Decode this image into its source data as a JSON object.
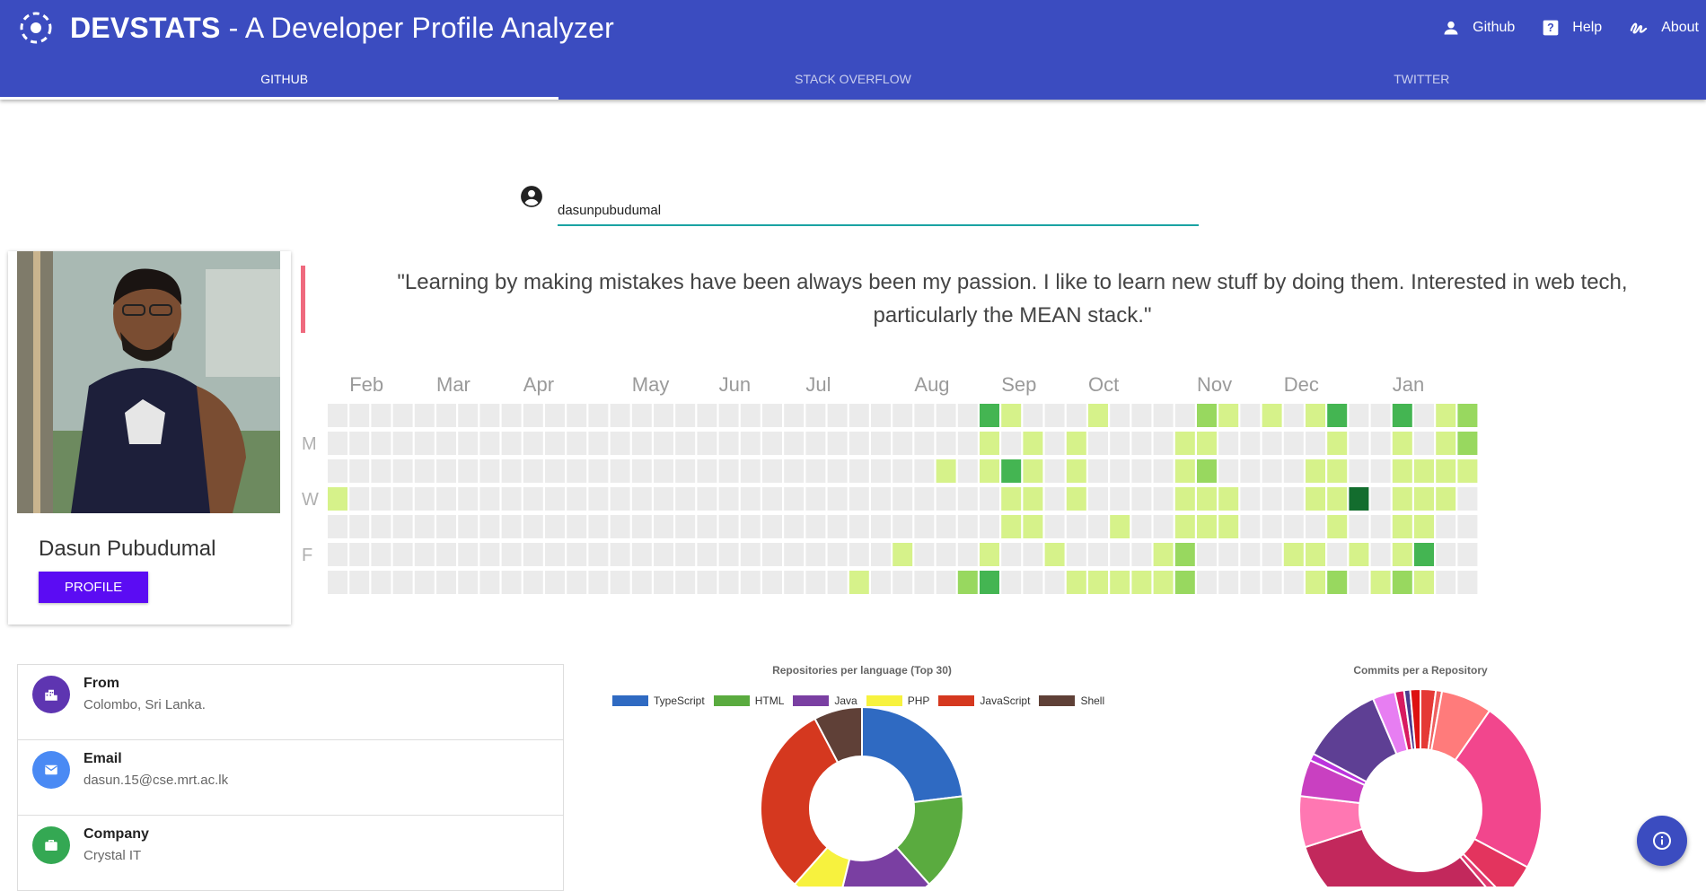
{
  "app": {
    "title_strong": "DEVSTATS",
    "title_rest": " - A Developer Profile Analyzer",
    "nav": [
      {
        "label": "Github",
        "icon": "person-icon"
      },
      {
        "label": "Help",
        "icon": "help-icon"
      },
      {
        "label": "About",
        "icon": "about-icon"
      }
    ],
    "tabs": [
      {
        "label": "GITHUB",
        "active": true
      },
      {
        "label": "STACK OVERFLOW",
        "active": false
      },
      {
        "label": "TWITTER",
        "active": false
      }
    ],
    "colors": {
      "primary": "#3b4cc0",
      "accent_button": "#5b0cf3"
    }
  },
  "search": {
    "value": "dasunpubudumal"
  },
  "profile": {
    "name": "Dasun Pubudumal",
    "button_label": "PROFILE"
  },
  "bio": "\"Learning by making mistakes have been always been my passion. I like to learn new stuff by doing them. Interested in web tech, particularly the MEAN stack.\"",
  "heatmap": {
    "months": [
      {
        "label": "Feb",
        "week": 1
      },
      {
        "label": "Mar",
        "week": 5
      },
      {
        "label": "Apr",
        "week": 9
      },
      {
        "label": "May",
        "week": 14
      },
      {
        "label": "Jun",
        "week": 18
      },
      {
        "label": "Jul",
        "week": 22
      },
      {
        "label": "Aug",
        "week": 27
      },
      {
        "label": "Sep",
        "week": 31
      },
      {
        "label": "Oct",
        "week": 35
      },
      {
        "label": "Nov",
        "week": 40
      },
      {
        "label": "Dec",
        "week": 44
      },
      {
        "label": "Jan",
        "week": 49
      }
    ],
    "day_labels": [
      {
        "label": "M",
        "row": 1
      },
      {
        "label": "W",
        "row": 3
      },
      {
        "label": "F",
        "row": 5
      }
    ],
    "colors": [
      "#ebebeb",
      "#d6f28a",
      "#98d85f",
      "#44b552",
      "#136d2e"
    ],
    "weeks": [
      [
        0,
        0,
        0,
        1,
        0,
        0,
        0
      ],
      [
        0,
        0,
        0,
        0,
        0,
        0,
        0
      ],
      [
        0,
        0,
        0,
        0,
        0,
        0,
        0
      ],
      [
        0,
        0,
        0,
        0,
        0,
        0,
        0
      ],
      [
        0,
        0,
        0,
        0,
        0,
        0,
        0
      ],
      [
        0,
        0,
        0,
        0,
        0,
        0,
        0
      ],
      [
        0,
        0,
        0,
        0,
        0,
        0,
        0
      ],
      [
        0,
        0,
        0,
        0,
        0,
        0,
        0
      ],
      [
        0,
        0,
        0,
        0,
        0,
        0,
        0
      ],
      [
        0,
        0,
        0,
        0,
        0,
        0,
        0
      ],
      [
        0,
        0,
        0,
        0,
        0,
        0,
        0
      ],
      [
        0,
        0,
        0,
        0,
        0,
        0,
        0
      ],
      [
        0,
        0,
        0,
        0,
        0,
        0,
        0
      ],
      [
        0,
        0,
        0,
        0,
        0,
        0,
        0
      ],
      [
        0,
        0,
        0,
        0,
        0,
        0,
        0
      ],
      [
        0,
        0,
        0,
        0,
        0,
        0,
        0
      ],
      [
        0,
        0,
        0,
        0,
        0,
        0,
        0
      ],
      [
        0,
        0,
        0,
        0,
        0,
        0,
        0
      ],
      [
        0,
        0,
        0,
        0,
        0,
        0,
        0
      ],
      [
        0,
        0,
        0,
        0,
        0,
        0,
        0
      ],
      [
        0,
        0,
        0,
        0,
        0,
        0,
        0
      ],
      [
        0,
        0,
        0,
        0,
        0,
        0,
        0
      ],
      [
        0,
        0,
        0,
        0,
        0,
        0,
        0
      ],
      [
        0,
        0,
        0,
        0,
        0,
        0,
        0
      ],
      [
        0,
        0,
        0,
        0,
        0,
        0,
        1
      ],
      [
        0,
        0,
        0,
        0,
        0,
        0,
        0
      ],
      [
        0,
        0,
        0,
        0,
        0,
        1,
        0
      ],
      [
        0,
        0,
        0,
        0,
        0,
        0,
        0
      ],
      [
        0,
        0,
        1,
        0,
        0,
        0,
        0
      ],
      [
        0,
        0,
        0,
        0,
        0,
        0,
        2
      ],
      [
        3,
        1,
        1,
        0,
        0,
        1,
        3
      ],
      [
        1,
        0,
        3,
        1,
        1,
        0,
        0
      ],
      [
        0,
        1,
        1,
        1,
        1,
        0,
        0
      ],
      [
        0,
        0,
        0,
        0,
        0,
        1,
        0
      ],
      [
        0,
        1,
        1,
        1,
        0,
        0,
        1
      ],
      [
        1,
        0,
        0,
        0,
        0,
        0,
        1
      ],
      [
        0,
        0,
        0,
        0,
        1,
        0,
        1
      ],
      [
        0,
        0,
        0,
        0,
        0,
        0,
        1
      ],
      [
        0,
        0,
        0,
        0,
        0,
        1,
        1
      ],
      [
        0,
        1,
        1,
        1,
        1,
        2,
        2
      ],
      [
        2,
        1,
        2,
        1,
        1,
        0,
        0
      ],
      [
        1,
        0,
        0,
        1,
        1,
        0,
        0
      ],
      [
        0,
        0,
        0,
        0,
        0,
        0,
        0
      ],
      [
        1,
        0,
        0,
        0,
        0,
        0,
        0
      ],
      [
        0,
        0,
        0,
        0,
        0,
        1,
        0
      ],
      [
        1,
        0,
        1,
        1,
        0,
        1,
        1
      ],
      [
        3,
        1,
        1,
        1,
        1,
        0,
        2
      ],
      [
        0,
        0,
        0,
        4,
        0,
        1,
        0
      ],
      [
        0,
        0,
        0,
        0,
        0,
        0,
        1
      ],
      [
        3,
        1,
        1,
        1,
        1,
        1,
        2
      ],
      [
        0,
        0,
        1,
        1,
        1,
        3,
        1
      ],
      [
        1,
        1,
        1,
        1,
        0,
        0,
        0
      ],
      [
        2,
        2,
        1,
        0,
        0,
        0,
        0
      ]
    ]
  },
  "info": [
    {
      "label": "From",
      "value": "Colombo, Sri Lanka.",
      "icon": "location-city-icon",
      "color": "#5e35b1"
    },
    {
      "label": "Email",
      "value": "dasun.15@cse.mrt.ac.lk",
      "icon": "email-icon",
      "color": "#4a8af4"
    },
    {
      "label": "Company",
      "value": "Crystal IT",
      "icon": "briefcase-icon",
      "color": "#34a853"
    }
  ],
  "chart_data": [
    {
      "type": "pie",
      "title": "Repositories per language (Top 30)",
      "legend_position": "top",
      "categories": [
        "TypeScript",
        "HTML",
        "Java",
        "PHP",
        "JavaScript",
        "Shell"
      ],
      "colors": [
        "#2f6ac2",
        "#5aab3f",
        "#7a3fa2",
        "#f7f23e",
        "#d5381f",
        "#5f4037"
      ],
      "values": [
        6,
        4,
        4,
        2,
        8,
        2
      ]
    },
    {
      "type": "pie",
      "title": "Commits per a Repository",
      "legend_position": "none",
      "colors": [
        "#e53935",
        "#ef6060",
        "#ff7b7b",
        "#f2468d",
        "#e3345e",
        "#e13a6f",
        "#c2285c",
        "#ff77b2",
        "#c940c1",
        "#b3d",
        "#5e3f94",
        "#e77ef2",
        "#d81b60",
        "#4b3b8f",
        "#d11"
      ],
      "values": [
        1.5,
        0.6,
        5,
        17,
        3.6,
        0.8,
        23,
        5,
        3.6,
        0.7,
        8,
        2.2,
        0.9,
        0.6,
        1
      ]
    }
  ],
  "fab": {
    "icon": "info-icon"
  }
}
